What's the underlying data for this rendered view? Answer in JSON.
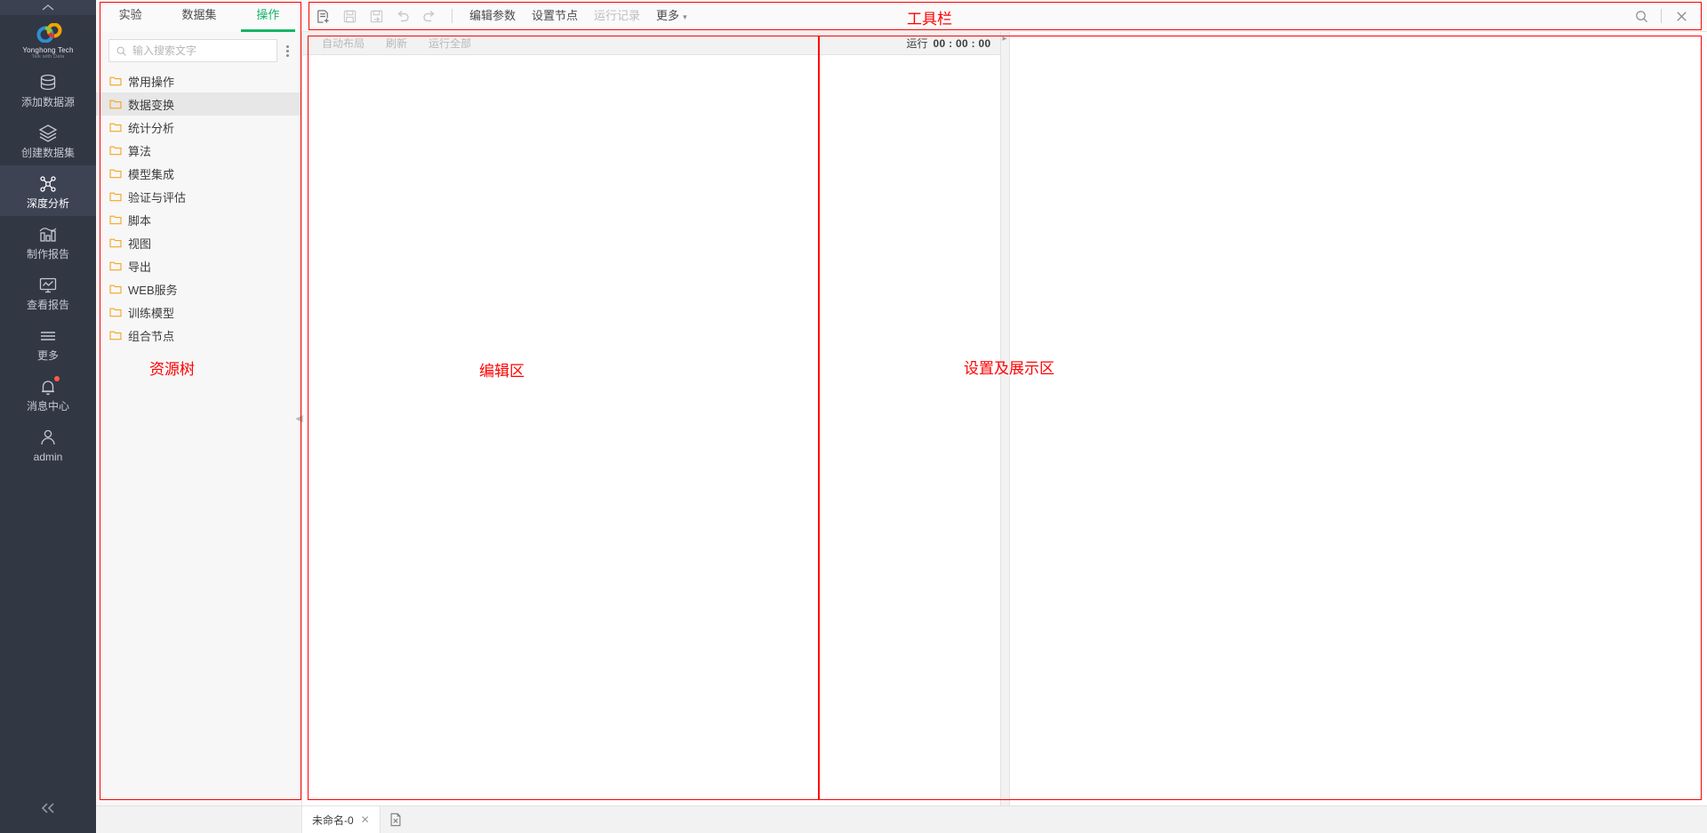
{
  "brand": {
    "name": "Yonghong Tech",
    "tagline": "Talk with Data"
  },
  "colors": {
    "nav_bg": "#323744",
    "nav_active": "#3d4353",
    "accent_green": "#18b566",
    "annotation_red": "#ff0000",
    "folder_orange": "#f5a623",
    "badge_red": "#ff5b4a"
  },
  "sidebar": {
    "collapse_top_icon": "chevron-up-icon",
    "collapse_bottom_icon": "double-chevron-left-icon",
    "items": [
      {
        "label": "添加数据源",
        "icon": "database-icon",
        "active": false,
        "badge": false
      },
      {
        "label": "创建数据集",
        "icon": "layers-icon",
        "active": false,
        "badge": false
      },
      {
        "label": "深度分析",
        "icon": "nodes-graph-icon",
        "active": true,
        "badge": false
      },
      {
        "label": "制作报告",
        "icon": "bar-chart-icon",
        "active": false,
        "badge": false
      },
      {
        "label": "查看报告",
        "icon": "monitor-chart-icon",
        "active": false,
        "badge": false
      },
      {
        "label": "更多",
        "icon": "hamburger-icon",
        "active": false,
        "badge": false
      },
      {
        "label": "消息中心",
        "icon": "bell-icon",
        "active": false,
        "badge": true
      },
      {
        "label": "admin",
        "icon": "user-icon",
        "active": false,
        "badge": false
      }
    ]
  },
  "panel_tabs": [
    {
      "label": "实验",
      "active": false
    },
    {
      "label": "数据集",
      "active": false
    },
    {
      "label": "操作",
      "active": true
    }
  ],
  "search": {
    "placeholder": "输入搜索文字",
    "value": "",
    "icon": "search-icon",
    "more_icon": "vertical-dots-icon"
  },
  "tree": {
    "items": [
      {
        "label": "常用操作",
        "selected": false
      },
      {
        "label": "数据变换",
        "selected": true
      },
      {
        "label": "统计分析",
        "selected": false
      },
      {
        "label": "算法",
        "selected": false
      },
      {
        "label": "模型集成",
        "selected": false
      },
      {
        "label": "验证与评估",
        "selected": false
      },
      {
        "label": "脚本",
        "selected": false
      },
      {
        "label": "视图",
        "selected": false
      },
      {
        "label": "导出",
        "selected": false
      },
      {
        "label": "WEB服务",
        "selected": false
      },
      {
        "label": "训练模型",
        "selected": false
      },
      {
        "label": "组合节点",
        "selected": false
      }
    ]
  },
  "toolbar": {
    "icons": [
      {
        "name": "new-experiment-icon",
        "disabled": false
      },
      {
        "name": "save-icon",
        "disabled": true
      },
      {
        "name": "save-as-icon",
        "disabled": true
      },
      {
        "name": "undo-icon",
        "disabled": true
      },
      {
        "name": "redo-icon",
        "disabled": true
      }
    ],
    "edit_params_label": "编辑参数",
    "set_node_label": "设置节点",
    "run_log_label": "运行记录",
    "more_label": "更多",
    "more_caret": "chevron-down-icon",
    "search_icon": "search-icon",
    "close_icon": "close-icon"
  },
  "editor_toolbar": {
    "auto_layout_label": "自动布局",
    "refresh_label": "刷新",
    "run_all_label": "运行全部",
    "run_label": "运行",
    "run_time": "00 : 00 : 00",
    "collapse_icon": "chevron-right-icon"
  },
  "bottom_bar": {
    "tab_label": "未命名-0",
    "close_icon": "close-icon",
    "add_icon": "add-sheet-icon"
  },
  "annotations": [
    {
      "label": "工具栏",
      "region": "toolbar"
    },
    {
      "label": "资源树",
      "region": "resource-tree"
    },
    {
      "label": "编辑区",
      "region": "editor-area"
    },
    {
      "label": "设置及展示区",
      "region": "settings-display-area"
    }
  ]
}
